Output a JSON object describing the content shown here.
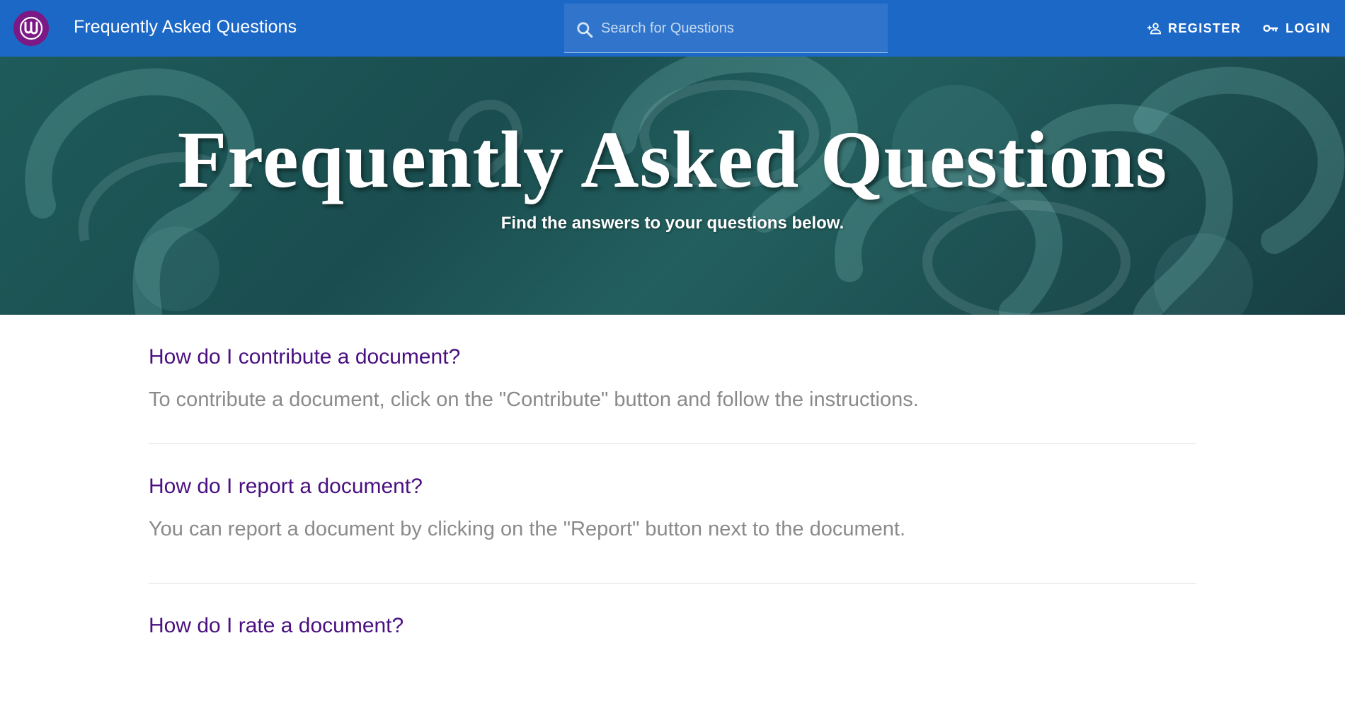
{
  "header": {
    "title": "Frequently Asked Questions",
    "logo_icon": "logo-icon",
    "search_placeholder": "Search for Questions",
    "register_label": "REGISTER",
    "login_label": "LOGIN",
    "brand_color": "#1c68c6",
    "logo_color": "#7b1a87"
  },
  "hero": {
    "title": "Frequently Asked Questions",
    "subtitle": "Find the answers to your questions below."
  },
  "faq": {
    "items": [
      {
        "question": "How do I contribute a document?",
        "answer": "To contribute a document, click on the \"Contribute\" button and follow the instructions."
      },
      {
        "question": "How do I report a document?",
        "answer": "You can report a document by clicking on the \"Report\" button next to the document."
      },
      {
        "question": "How do I rate a document?",
        "answer": ""
      }
    ],
    "question_color": "#4a0f80",
    "answer_color": "#8a8a8a"
  }
}
